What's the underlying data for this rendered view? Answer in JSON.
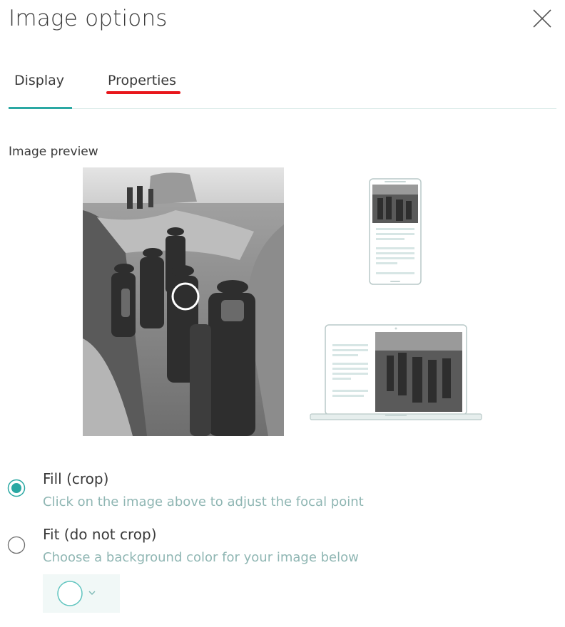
{
  "dialog": {
    "title": "Image options",
    "close_icon": "close-icon"
  },
  "tabs": [
    {
      "label": "Display",
      "active": true
    },
    {
      "label": "Properties",
      "active": false
    }
  ],
  "preview": {
    "label": "Image preview"
  },
  "options": {
    "fill": {
      "label": "Fill (crop)",
      "help": "Click on the image above to adjust the focal point",
      "selected": true
    },
    "fit": {
      "label": "Fit (do not crop)",
      "help": "Choose a background color for your image below",
      "selected": false
    }
  },
  "color_picker": {
    "icon": "chevron-down-icon",
    "swatch_color": "#ffffff"
  },
  "colors": {
    "accent": "#2aa8a3",
    "annotation": "#e8161b",
    "help_text": "#8fb6b3"
  }
}
